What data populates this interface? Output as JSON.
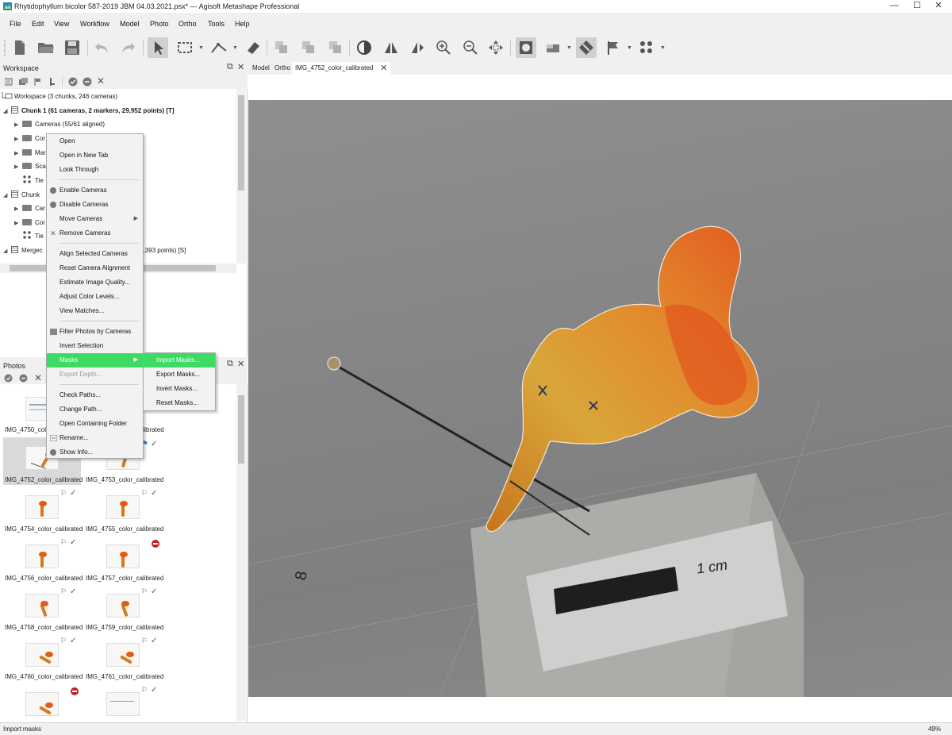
{
  "window": {
    "title": "Rhytidophyllum bicolor 587-2019 JBM 04.03.2021.psx* — Agisoft Metashape Professional",
    "minimize": "—",
    "maximize": "☐",
    "close": "✕"
  },
  "menu": [
    "File",
    "Edit",
    "View",
    "Workflow",
    "Model",
    "Photo",
    "Ortho",
    "Tools",
    "Help"
  ],
  "toolbar": {
    "icons": [
      "new-document-icon",
      "open-folder-icon",
      "save-icon",
      "undo-icon",
      "redo-icon",
      "navigation-arrow-icon",
      "rectangle-selection-icon",
      "ruler-icon",
      "eraser-icon",
      "duplicate-1-icon",
      "duplicate-2-icon",
      "duplicate-3-icon",
      "contrast-icon",
      "split-view-icon",
      "flip-view-icon",
      "zoom-in-icon",
      "zoom-out-icon",
      "move-cross-icon",
      "mask-frame-icon",
      "shading-icon",
      "diamond-icon",
      "flag-icon",
      "points-icon"
    ]
  },
  "workspace": {
    "title": "Workspace",
    "tree": [
      {
        "label": "Workspace (3 chunks, 246 cameras)",
        "bold": false
      },
      {
        "label": "Chunk 1 (61 cameras, 2 markers, 29,952 points) [T]",
        "bold": true
      },
      {
        "label": "Cameras (55/61 aligned)"
      },
      {
        "label": "Cor"
      },
      {
        "label": "Mar"
      },
      {
        "label": "Sca"
      },
      {
        "label": "Tie"
      },
      {
        "label": "Chunk"
      },
      {
        "label": "Car"
      },
      {
        "label": "Cor"
      },
      {
        "label": "Tie"
      },
      {
        "label": "Mergec"
      },
      {
        "label": "5,393 points) [S]"
      }
    ]
  },
  "tabs": [
    "Model",
    "Ortho",
    "IMG_4752_color_calibrated"
  ],
  "viewer": {
    "scale_label": "1 cm",
    "ruler_mark": "8"
  },
  "photos": {
    "title": "Photos",
    "items": [
      {
        "label": "IMG_4750_colo",
        "status": "none"
      },
      {
        "label": "alibrated",
        "status": "check"
      },
      {
        "label": "IMG_4752_color_calibrated",
        "status": "selected"
      },
      {
        "label": "IMG_4753_color_calibrated",
        "status": "check"
      },
      {
        "label": "IMG_4754_color_calibrated",
        "status": "check"
      },
      {
        "label": "IMG_4755_color_calibrated",
        "status": "disabled"
      },
      {
        "label": "IMG_4756_color_calibrated",
        "status": "check"
      },
      {
        "label": "IMG_4757_color_calibrated",
        "status": "check"
      },
      {
        "label": "IMG_4758_color_calibrated",
        "status": "check"
      },
      {
        "label": "IMG_4759_color_calibrated",
        "status": "check"
      },
      {
        "label": "IMG_4760_color_calibrated",
        "status": "disabled"
      },
      {
        "label": "IMG_4761_color_calibrated",
        "status": "check"
      }
    ]
  },
  "context_menu": {
    "items": {
      "open": "Open",
      "open_new_tab": "Open in New Tab",
      "look_through": "Look Through",
      "enable_cameras": "Enable Cameras",
      "disable_cameras": "Disable Cameras",
      "move_cameras": "Move Cameras",
      "remove_cameras": "Remove Cameras",
      "align_selected": "Align Selected Cameras",
      "reset_alignment": "Reset Camera Alignment",
      "estimate_quality": "Estimate Image Quality...",
      "adjust_color": "Adjust Color Levels...",
      "view_matches": "View Matches...",
      "filter_photos": "Filter Photos by Cameras",
      "invert_selection": "Invert Selection",
      "masks": "Masks",
      "export_depth": "Export Depth...",
      "check_paths": "Check Paths...",
      "change_path": "Change Path...",
      "open_folder": "Open Containing Folder",
      "rename": "Rename...",
      "show_info": "Show Info..."
    },
    "submenu": {
      "import_masks": "Import Masks...",
      "export_masks": "Export Masks...",
      "invert_masks": "Invert Masks...",
      "reset_masks": "Reset Masks..."
    },
    "highlight_color": "#3ddb63"
  },
  "status": {
    "text": "Import masks",
    "zoom": "49%"
  }
}
